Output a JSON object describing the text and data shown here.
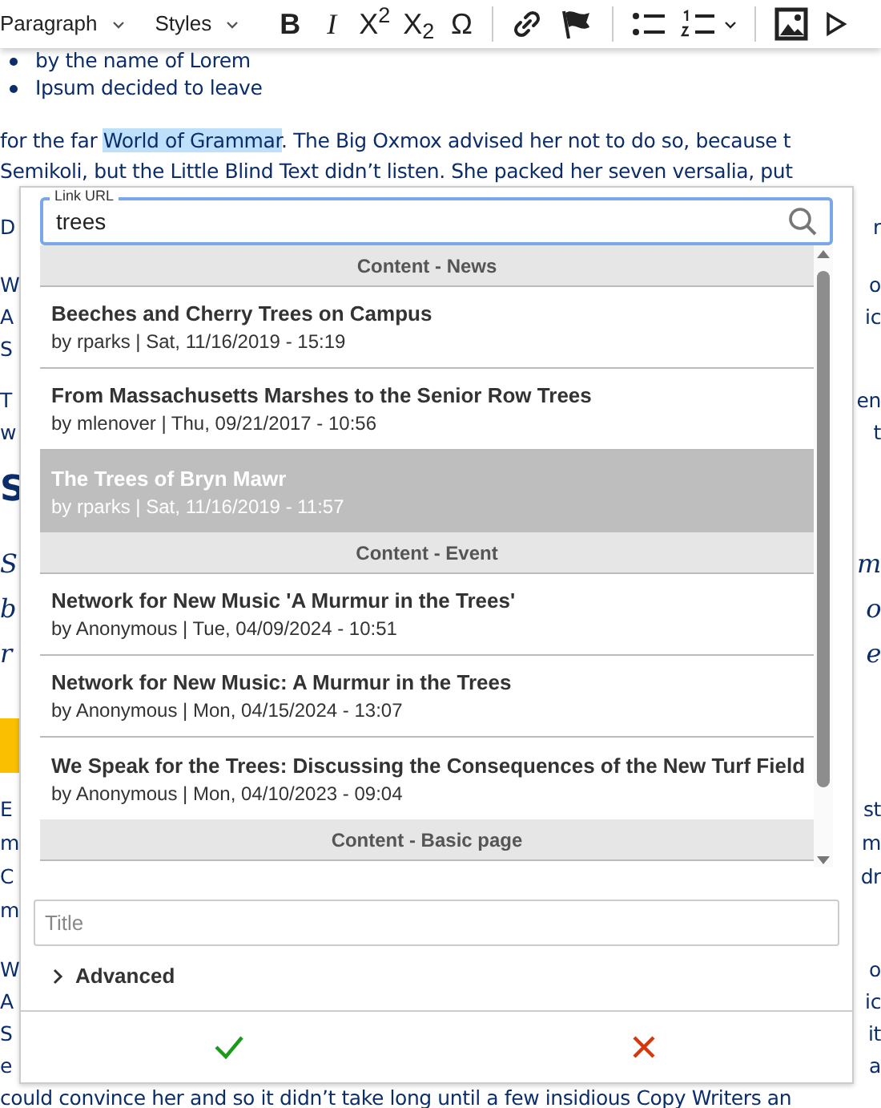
{
  "toolbar": [
    {
      "kind": "dropdown",
      "label": "Paragraph"
    },
    {
      "kind": "dropdown",
      "label": "Styles"
    },
    {
      "kind": "bold",
      "label": "B"
    },
    {
      "kind": "italic",
      "label": "I"
    },
    {
      "kind": "glyph",
      "label": "X$^{2}$"
    },
    {
      "kind": "glyph",
      "label": "X$_{2}$"
    },
    {
      "kind": "glyph",
      "label": "Ω"
    },
    {
      "kind": "separator"
    },
    {
      "kind": "link"
    },
    {
      "kind": "flag"
    },
    {
      "kind": "separator"
    },
    {
      "kind": "bullets"
    },
    {
      "kind": "numbers"
    },
    {
      "kind": "separator"
    },
    {
      "kind": "image"
    },
    {
      "kind": "play"
    }
  ],
  "document": [
    {
      "kind": "bullet",
      "text": "by the name of Lorem"
    },
    {
      "kind": "bullet",
      "text": "Ipsum decided to leave"
    },
    {
      "kind": "highlighted",
      "before": "for the far ",
      "highlight": "World of Grammar",
      "after": ". The Big Oxmox advised her not to do so, because t"
    },
    {
      "kind": "text",
      "text": "Semikoli, but the Little Blind Text didn’t listen. She packed her seven versalia, put"
    },
    {
      "kind": "split",
      "left": "D",
      "right": "r"
    },
    {
      "kind": "split",
      "left": "W",
      "right": "o"
    },
    {
      "kind": "split",
      "left": "A",
      "right": "ic"
    },
    {
      "kind": "split",
      "left": "S"
    },
    {
      "kind": "split",
      "left": "T",
      "right": "en"
    },
    {
      "kind": "split",
      "left": "w",
      "right": "t"
    },
    {
      "kind": "heading",
      "left": "S"
    },
    {
      "kind": "italic",
      "left": "S",
      "right": "m"
    },
    {
      "kind": "italic",
      "left": "b",
      "right": "o"
    },
    {
      "kind": "italic",
      "left": "r",
      "right": "e"
    },
    {
      "kind": "band"
    },
    {
      "kind": "split",
      "left": "E",
      "right": "st"
    },
    {
      "kind": "split",
      "left": "m",
      "right": "m"
    },
    {
      "kind": "split",
      "left": "C",
      "right": "dr"
    },
    {
      "kind": "split",
      "left": "m"
    },
    {
      "kind": "split",
      "left": "W",
      "right": "o"
    },
    {
      "kind": "split",
      "left": "A",
      "right": "ic"
    },
    {
      "kind": "split",
      "left": "S",
      "right": "it"
    },
    {
      "kind": "split",
      "left": "e",
      "right": "a"
    },
    {
      "kind": "text",
      "text": "could convince her and so it didn’t take long until a few insidious Copy Writers an"
    }
  ],
  "link_dialog": {
    "url_field": {
      "label": "Link URL",
      "value": "trees"
    },
    "results": [
      {
        "heading": "Content - News",
        "items": [
          {
            "title": "Beeches and Cherry Trees on Campus",
            "meta": "by rparks | Sat, 11/16/2019 - 15:19",
            "selected": false
          },
          {
            "title": "From Massachusetts Marshes to the Senior Row Trees",
            "meta": "by mlenover | Thu, 09/21/2017 - 10:56",
            "selected": false
          },
          {
            "title": "The Trees of Bryn Mawr",
            "meta": "by rparks | Sat, 11/16/2019 - 11:57",
            "selected": true
          }
        ]
      },
      {
        "heading": "Content - Event",
        "items": [
          {
            "title": "Network for New Music 'A Murmur in the Trees'",
            "meta": "by Anonymous | Tue, 04/09/2024 - 10:51",
            "selected": false
          },
          {
            "title": "Network for New Music: A Murmur in the Trees",
            "meta": "by Anonymous | Mon, 04/15/2024 - 13:07",
            "selected": false
          },
          {
            "title": "We Speak for the Trees: Discussing the Consequences of the New Turf Field",
            "meta": "by Anonymous | Mon, 04/10/2023 - 09:04",
            "selected": false
          }
        ]
      },
      {
        "heading": "Content - Basic page"
      }
    ],
    "title_field": {
      "placeholder": "Title"
    },
    "advanced": {
      "label": "Advanced",
      "expanded": false
    }
  }
}
